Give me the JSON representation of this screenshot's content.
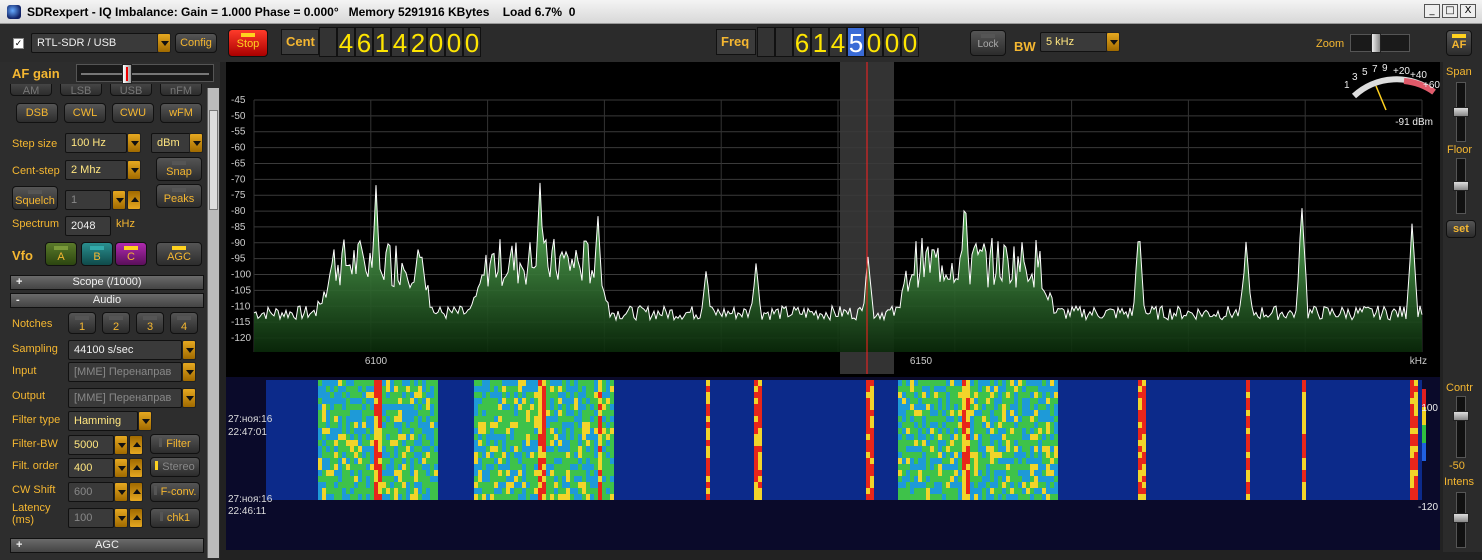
{
  "window": {
    "title": "SDRexpert - IQ Imbalance: Gain = 1.000 Phase = 0.000°   Memory 5291916 KBytes    Load 6.7%  0",
    "buttons": [
      "_",
      "□",
      "X"
    ]
  },
  "toolbar": {
    "device": "RTL-SDR / USB",
    "config": "Config",
    "stop": "Stop",
    "cent_label": "Cent",
    "cent_digits": [
      "",
      "4",
      "6",
      "1",
      "4",
      "2",
      "0",
      "0",
      "0"
    ],
    "freq_label": "Freq",
    "freq_digits": [
      "",
      "",
      "6",
      "1",
      "4",
      "5",
      "0",
      "0",
      "0"
    ],
    "freq_highlight_index": 5,
    "lock": "Lock",
    "bw_label": "BW",
    "bw_value": "5 kHz",
    "zoom_label": "Zoom",
    "af_button": "AF"
  },
  "left": {
    "af_gain_label": "AF gain",
    "af_gain_level": 0.36,
    "modes_row1": [
      "AM",
      "LSB",
      "USB",
      "nFM"
    ],
    "modes_row2": [
      "DSB",
      "CWL",
      "CWU",
      "wFM"
    ],
    "step_size_label": "Step size",
    "step_size": "100 Hz",
    "unit": "dBm",
    "cent_step_label": "Cent-step",
    "cent_step": "2 Mhz",
    "snap": "Snap",
    "squelch": "Squelch",
    "squelch_value": "1",
    "peaks": "Peaks",
    "spectrum_label": "Spectrum",
    "spectrum_value": "2048",
    "spectrum_unit": "kHz",
    "vfo_label": "Vfo",
    "vfo_a": "A",
    "vfo_b": "B",
    "vfo_c": "C",
    "agc_btn": "AGC",
    "scope_section": "Scope (/1000)",
    "audio_section": "Audio",
    "notches_label": "Notches",
    "notches": [
      "1",
      "2",
      "3",
      "4"
    ],
    "sampling_label": "Sampling",
    "sampling": "44100 s/sec",
    "input_label": "Input",
    "input": "[MME] Перенаправ",
    "output_label": "Output",
    "output": "[MME] Перенаправ",
    "filter_type_label": "Filter type",
    "filter_type": "Hamming",
    "filter_bw_label": "Filter-BW",
    "filter_bw": "5000",
    "filter_btn": "Filter",
    "filt_order_label": "Filt. order",
    "filt_order": "400",
    "stereo_btn": "Stereo",
    "cw_shift_label": "CW Shift",
    "cw_shift": "600",
    "fconv_btn": "F-conv.",
    "latency_label": "Latency",
    "latency_unit": "(ms)",
    "latency": "100",
    "chk1_btn": "chk1",
    "agc_section": "AGC"
  },
  "spectrum": {
    "y_ticks": [
      "-45",
      "-50",
      "-55",
      "-60",
      "-65",
      "-70",
      "-75",
      "-80",
      "-85",
      "-90",
      "-95",
      "-100",
      "-105",
      "-110",
      "-115",
      "-120"
    ],
    "x_ticks": [
      "6100",
      "6150"
    ],
    "x_unit": "kHz",
    "meter_scale": [
      "1",
      "3",
      "5",
      "7",
      "9",
      "+20",
      "+40",
      "+60"
    ],
    "meter_reading": "-91 dBm",
    "trace_color": "#ffffff",
    "fill_color": "#2e7d32"
  },
  "waterfall": {
    "ts1_date": "27:ноя:16",
    "ts1_time": "22:47:01",
    "ts2_date": "27:ноя:16",
    "ts2_time": "22:46:11",
    "scale_top": "100",
    "scale_mid": "-50",
    "scale_bottom": "-120"
  },
  "right": {
    "span": "Span",
    "floor": "Floor",
    "set": "set",
    "contr": "Contr",
    "intens": "Intens"
  }
}
